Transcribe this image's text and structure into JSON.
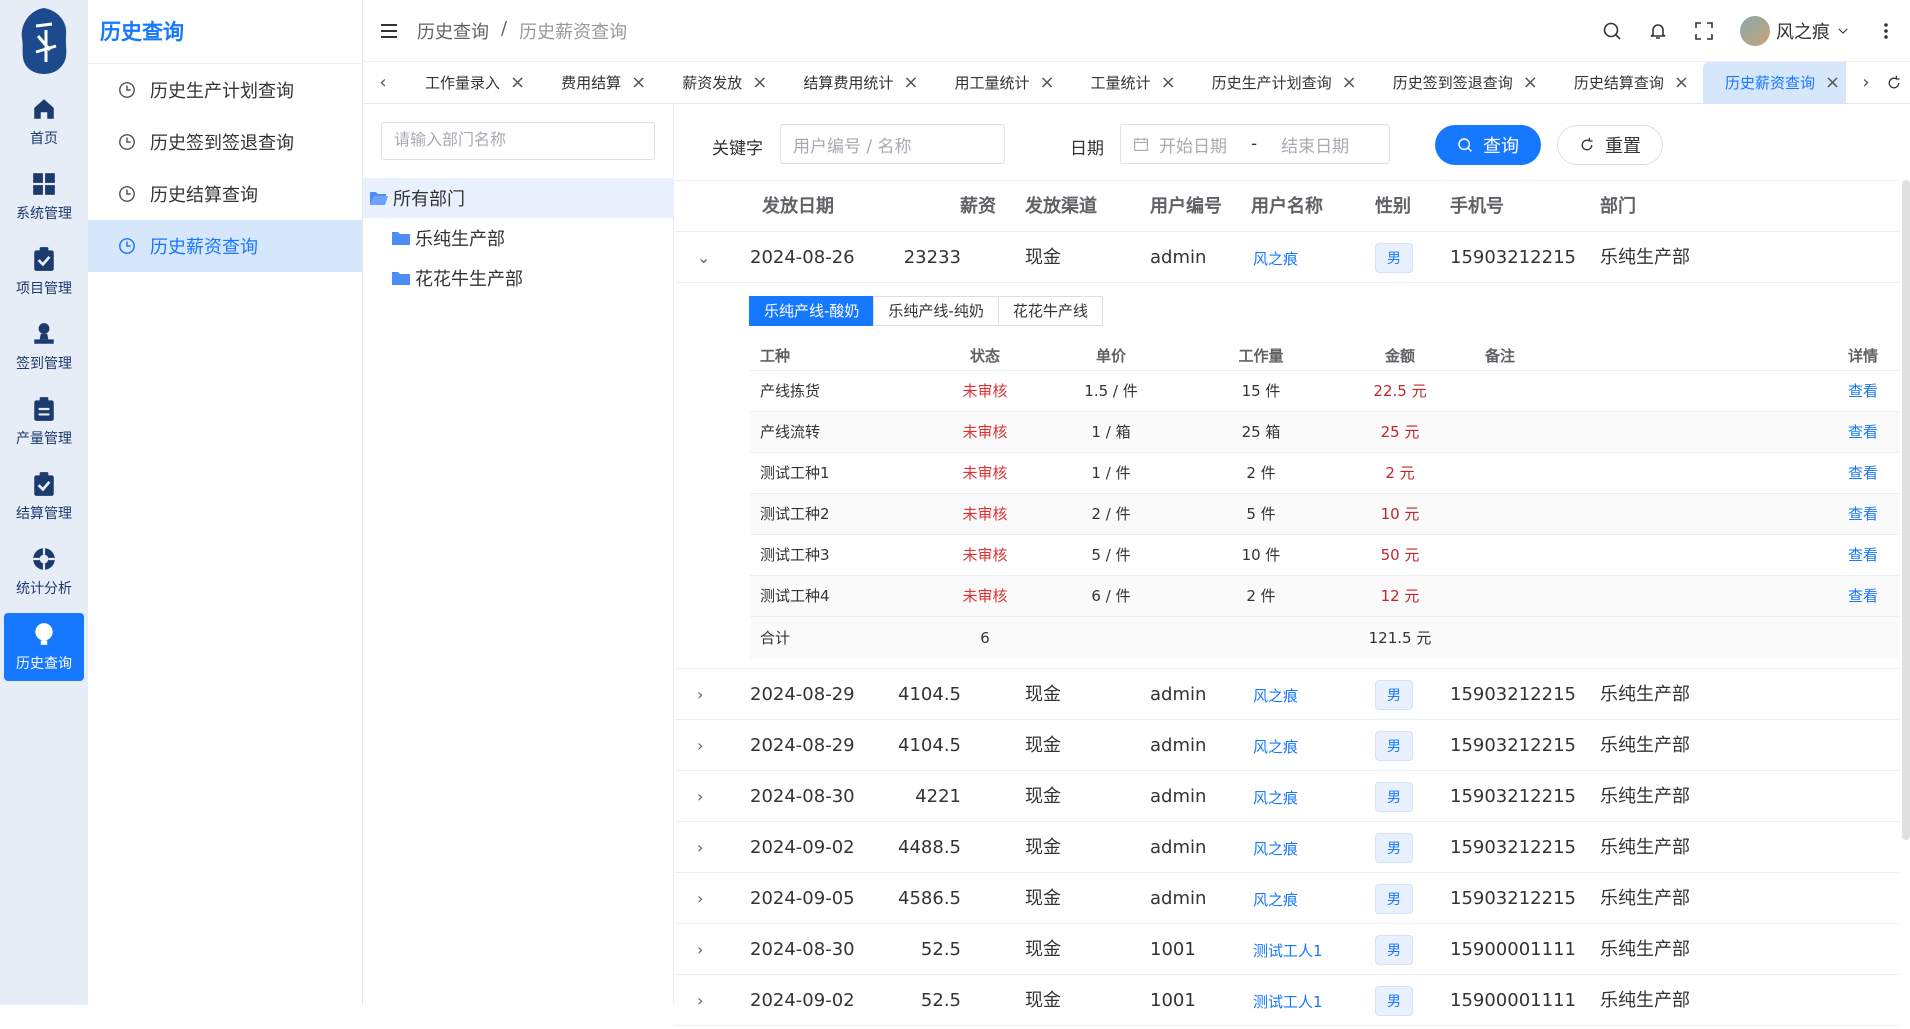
{
  "rail": {
    "items": [
      {
        "label": "首页",
        "icon": "home-icon"
      },
      {
        "label": "系统管理",
        "icon": "grid-icon"
      },
      {
        "label": "项目管理",
        "icon": "clipboard-check-icon"
      },
      {
        "label": "签到管理",
        "icon": "user-stamp-icon"
      },
      {
        "label": "产量管理",
        "icon": "clipboard-list-icon"
      },
      {
        "label": "结算管理",
        "icon": "clipboard-check-icon"
      },
      {
        "label": "统计分析",
        "icon": "lifebuoy-icon"
      },
      {
        "label": "历史查询",
        "icon": "lightbulb-icon"
      }
    ]
  },
  "submenu": {
    "title": "历史查询",
    "items": [
      {
        "label": "历史生产计划查询"
      },
      {
        "label": "历史签到签退查询"
      },
      {
        "label": "历史结算查询"
      },
      {
        "label": "历史薪资查询"
      }
    ]
  },
  "breadcrumb": {
    "first": "历史查询",
    "sep": "/",
    "last": "历史薪资查询"
  },
  "user": {
    "name": "风之痕"
  },
  "tabs": [
    "工作量录入",
    "费用结算",
    "薪资发放",
    "结算费用统计",
    "用工量统计",
    "工量统计",
    "历史生产计划查询",
    "历史签到签退查询",
    "历史结算查询",
    "历史薪资查询"
  ],
  "tree": {
    "search_placeholder": "请输入部门名称",
    "nodes": [
      "所有部门",
      "乐纯生产部",
      "花花牛生产部"
    ]
  },
  "query": {
    "keyword_label": "关键字",
    "keyword_placeholder": "用户编号 / 名称",
    "date_label": "日期",
    "start_placeholder": "开始日期",
    "date_sep": "-",
    "end_placeholder": "结束日期",
    "search_button": "查询",
    "reset_button": "重置"
  },
  "table": {
    "headers": [
      "发放日期",
      "薪资",
      "发放渠道",
      "用户编号",
      "用户名称",
      "性别",
      "手机号",
      "部门"
    ],
    "rows": [
      {
        "date": "2024-08-26",
        "salary": "23233",
        "channel": "现金",
        "uid": "admin",
        "uname": "风之痕",
        "sex": "男",
        "phone": "15903212215",
        "dept": "乐纯生产部"
      },
      {
        "date": "2024-08-29",
        "salary": "4104.5",
        "channel": "现金",
        "uid": "admin",
        "uname": "风之痕",
        "sex": "男",
        "phone": "15903212215",
        "dept": "乐纯生产部"
      },
      {
        "date": "2024-08-29",
        "salary": "4104.5",
        "channel": "现金",
        "uid": "admin",
        "uname": "风之痕",
        "sex": "男",
        "phone": "15903212215",
        "dept": "乐纯生产部"
      },
      {
        "date": "2024-08-30",
        "salary": "4221",
        "channel": "现金",
        "uid": "admin",
        "uname": "风之痕",
        "sex": "男",
        "phone": "15903212215",
        "dept": "乐纯生产部"
      },
      {
        "date": "2024-09-02",
        "salary": "4488.5",
        "channel": "现金",
        "uid": "admin",
        "uname": "风之痕",
        "sex": "男",
        "phone": "15903212215",
        "dept": "乐纯生产部"
      },
      {
        "date": "2024-09-05",
        "salary": "4586.5",
        "channel": "现金",
        "uid": "admin",
        "uname": "风之痕",
        "sex": "男",
        "phone": "15903212215",
        "dept": "乐纯生产部"
      },
      {
        "date": "2024-08-30",
        "salary": "52.5",
        "channel": "现金",
        "uid": "1001",
        "uname": "测试工人1",
        "sex": "男",
        "phone": "15900001111",
        "dept": "乐纯生产部"
      },
      {
        "date": "2024-09-02",
        "salary": "52.5",
        "channel": "现金",
        "uid": "1001",
        "uname": "测试工人1",
        "sex": "男",
        "phone": "15900001111",
        "dept": "乐纯生产部"
      }
    ]
  },
  "detail": {
    "segments": [
      "乐纯产线-酸奶",
      "乐纯产线-纯奶",
      "花花牛产线"
    ],
    "headers": [
      "工种",
      "状态",
      "单价",
      "工作量",
      "金额",
      "备注",
      "详情"
    ],
    "rows": [
      {
        "type": "产线拣货",
        "status": "未审核",
        "price": "1.5 / 件",
        "qty": "15 件",
        "amount": "22.5 元",
        "note": "",
        "action": "查看"
      },
      {
        "type": "产线流转",
        "status": "未审核",
        "price": "1 / 箱",
        "qty": "25 箱",
        "amount": "25 元",
        "note": "",
        "action": "查看"
      },
      {
        "type": "测试工种1",
        "status": "未审核",
        "price": "1 / 件",
        "qty": "2 件",
        "amount": "2 元",
        "note": "",
        "action": "查看"
      },
      {
        "type": "测试工种2",
        "status": "未审核",
        "price": "2 / 件",
        "qty": "5 件",
        "amount": "10 元",
        "note": "",
        "action": "查看"
      },
      {
        "type": "测试工种3",
        "status": "未审核",
        "price": "5 / 件",
        "qty": "10 件",
        "amount": "50 元",
        "note": "",
        "action": "查看"
      },
      {
        "type": "测试工种4",
        "status": "未审核",
        "price": "6 / 件",
        "qty": "2 件",
        "amount": "12 元",
        "note": "",
        "action": "查看"
      }
    ],
    "total": {
      "label": "合计",
      "count": "6",
      "amount": "121.5 元"
    }
  }
}
